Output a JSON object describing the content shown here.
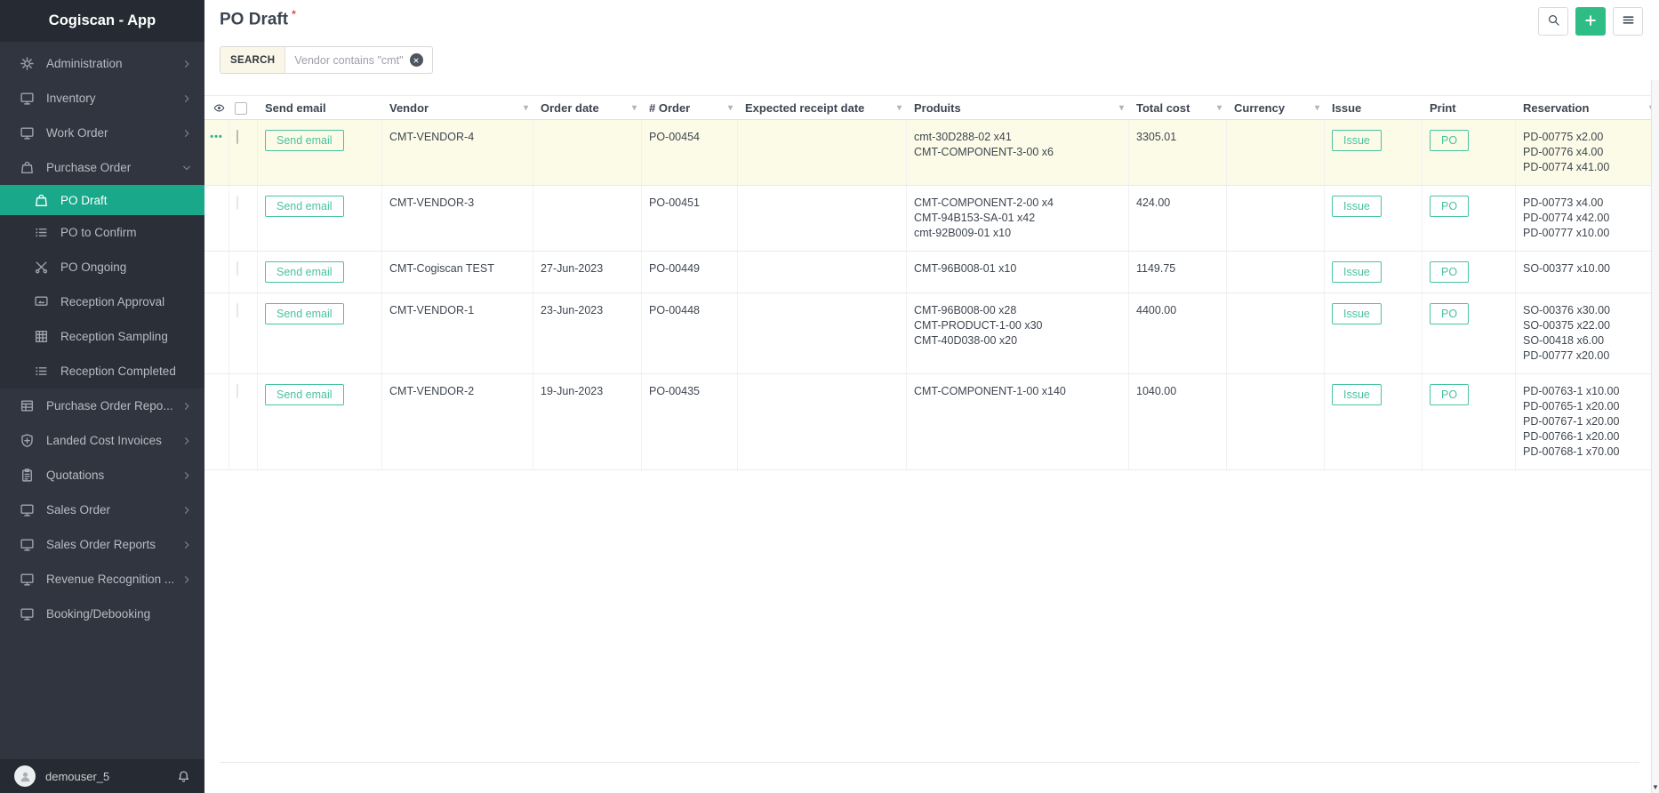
{
  "app": {
    "title": "Cogiscan - App"
  },
  "sidebar": {
    "items": [
      {
        "label": "Administration",
        "icon": "gear",
        "chevron": "right"
      },
      {
        "label": "Inventory",
        "icon": "monitor",
        "chevron": "right"
      },
      {
        "label": "Work Order",
        "icon": "monitor",
        "chevron": "right"
      },
      {
        "label": "Purchase Order",
        "icon": "bag",
        "chevron": "down",
        "expanded": true
      },
      {
        "label": "PO Draft",
        "icon": "bag",
        "sub": true,
        "active": true
      },
      {
        "label": "PO to Confirm",
        "icon": "list",
        "sub": true
      },
      {
        "label": "PO Ongoing",
        "icon": "scissors",
        "sub": true
      },
      {
        "label": "Reception Approval",
        "icon": "monitor-image",
        "sub": true
      },
      {
        "label": "Reception Sampling",
        "icon": "grid",
        "sub": true
      },
      {
        "label": "Reception Completed",
        "icon": "list",
        "sub": true
      },
      {
        "label": "Purchase Order Repo...",
        "icon": "table",
        "chevron": "right"
      },
      {
        "label": "Landed Cost Invoices",
        "icon": "shield",
        "chevron": "right"
      },
      {
        "label": "Quotations",
        "icon": "clipboard",
        "chevron": "right"
      },
      {
        "label": "Sales Order",
        "icon": "monitor",
        "chevron": "right"
      },
      {
        "label": "Sales Order Reports",
        "icon": "monitor",
        "chevron": "right"
      },
      {
        "label": "Revenue Recognition ...",
        "icon": "monitor",
        "chevron": "right"
      },
      {
        "label": "Booking/Debooking",
        "icon": "monitor"
      }
    ],
    "user": {
      "name": "demouser_5"
    }
  },
  "header": {
    "title": "PO Draft",
    "required_marker": "*"
  },
  "search": {
    "label": "SEARCH",
    "filter": "Vendor contains \"cmt\""
  },
  "table": {
    "columns": [
      {
        "label": "Send email",
        "sortable": false
      },
      {
        "label": "Vendor",
        "sortable": true
      },
      {
        "label": "Order date",
        "sortable": true
      },
      {
        "label": "# Order",
        "sortable": true
      },
      {
        "label": "Expected receipt date",
        "sortable": true
      },
      {
        "label": "Produits",
        "sortable": true
      },
      {
        "label": "Total cost",
        "sortable": true
      },
      {
        "label": "Currency",
        "sortable": true
      },
      {
        "label": "Issue",
        "sortable": false
      },
      {
        "label": "Print",
        "sortable": false
      },
      {
        "label": "Reservation",
        "sortable": true
      }
    ],
    "buttons": {
      "send_email": "Send email",
      "issue": "Issue",
      "print": "PO"
    },
    "rows": [
      {
        "highlighted": true,
        "actions_menu": true,
        "vendor": "CMT-VENDOR-4",
        "order_date": "",
        "order_no": "PO-00454",
        "expected_receipt_date": "",
        "produits": [
          "cmt-30D288-02 x41",
          "CMT-COMPONENT-3-00 x6"
        ],
        "total_cost": "3305.01",
        "currency": "",
        "reservation": [
          "PD-00775 x2.00",
          "PD-00776 x4.00",
          "PD-00774 x41.00"
        ]
      },
      {
        "highlighted": false,
        "actions_menu": false,
        "vendor": "CMT-VENDOR-3",
        "order_date": "",
        "order_no": "PO-00451",
        "expected_receipt_date": "",
        "produits": [
          "CMT-COMPONENT-2-00 x4",
          "CMT-94B153-SA-01 x42",
          "cmt-92B009-01 x10"
        ],
        "total_cost": "424.00",
        "currency": "",
        "reservation": [
          "PD-00773 x4.00",
          "PD-00774 x42.00",
          "PD-00777 x10.00"
        ]
      },
      {
        "highlighted": false,
        "actions_menu": false,
        "vendor": "CMT-Cogiscan TEST",
        "order_date": "27-Jun-2023",
        "order_no": "PO-00449",
        "expected_receipt_date": "",
        "produits": [
          "CMT-96B008-01 x10"
        ],
        "total_cost": "1149.75",
        "currency": "",
        "reservation": [
          "SO-00377 x10.00"
        ]
      },
      {
        "highlighted": false,
        "actions_menu": false,
        "vendor": "CMT-VENDOR-1",
        "order_date": "23-Jun-2023",
        "order_no": "PO-00448",
        "expected_receipt_date": "",
        "produits": [
          "CMT-96B008-00 x28",
          "CMT-PRODUCT-1-00 x30",
          "CMT-40D038-00 x20"
        ],
        "total_cost": "4400.00",
        "currency": "",
        "reservation": [
          "SO-00376 x30.00",
          "SO-00375 x22.00",
          "SO-00418 x6.00",
          "PD-00777 x20.00"
        ]
      },
      {
        "highlighted": false,
        "actions_menu": false,
        "vendor": "CMT-VENDOR-2",
        "order_date": "19-Jun-2023",
        "order_no": "PO-00435",
        "expected_receipt_date": "",
        "produits": [
          "CMT-COMPONENT-1-00 x140"
        ],
        "total_cost": "1040.00",
        "currency": "",
        "reservation": [
          "PD-00763-1 x10.00",
          "PD-00765-1 x20.00",
          "PD-00767-1 x20.00",
          "PD-00766-1 x20.00",
          "PD-00768-1 x70.00"
        ]
      }
    ]
  },
  "colors": {
    "accent_teal": "#49c2a1",
    "active_green": "#1aa88a",
    "add_button_green": "#2ebd85",
    "highlight_row": "#fcfbe7",
    "required_red": "#e8473f"
  }
}
